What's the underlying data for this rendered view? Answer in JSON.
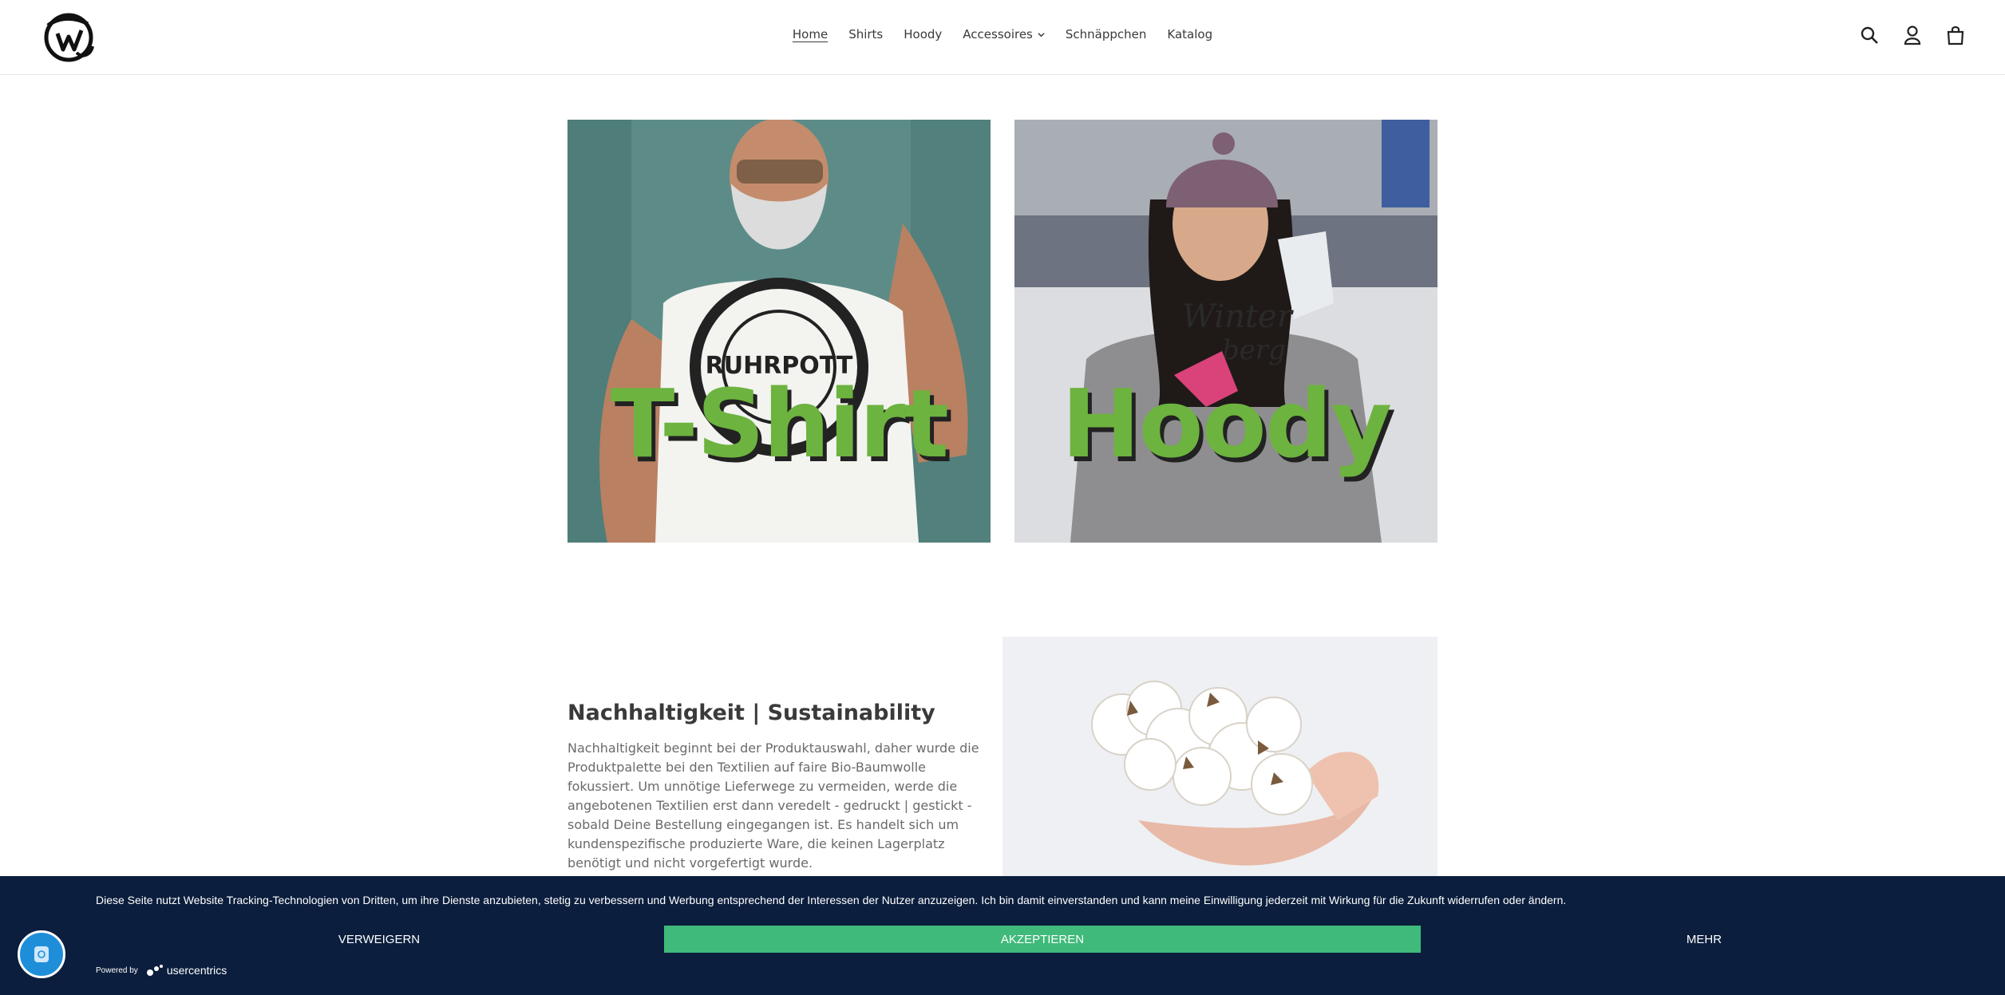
{
  "header": {
    "nav": [
      {
        "label": "Home",
        "active": true
      },
      {
        "label": "Shirts"
      },
      {
        "label": "Hoody"
      },
      {
        "label": "Accessoires",
        "dropdown": true
      },
      {
        "label": "Schnäppchen"
      },
      {
        "label": "Katalog"
      }
    ],
    "icons": [
      "search-icon",
      "account-icon",
      "cart-icon"
    ]
  },
  "tiles": [
    {
      "label": "T-Shirt",
      "image": "man-in-ruhrpott-shirt"
    },
    {
      "label": "Hoody",
      "image": "woman-in-winterberg-hoody"
    }
  ],
  "sustainability": {
    "title": "Nachhaltigkeit | Sustainability",
    "lines": [
      "Nachhaltigkeit beginnt bei der Produktauswahl, daher wurde die",
      "Produktpalette bei den Textilien auf faire Bio-Baumwolle",
      "fokussiert. Um unnötige Lieferwege zu vermeiden, werde die",
      "angebotenen Textilien erst dann veredelt - gedruckt | gestickt -",
      "sobald Deine Bestellung eingegangen ist. Es handelt sich um",
      "kundenspezifische produzierte Ware, die keinen Lagerplatz",
      "benötigt und nicht vorgefertigt wurde."
    ]
  },
  "cookie": {
    "text": "Diese Seite nutzt Website Tracking-Technologien von Dritten, um ihre Dienste anzubieten, stetig zu verbessern und Werbung entsprechend der Interessen der Nutzer anzuzeigen. Ich bin damit einverstanden und kann meine Einwilligung jederzeit mit Wirkung für die Zukunft widerrufen oder ändern.",
    "deny_label": "VERWEIGERN",
    "accept_label": "AKZEPTIEREN",
    "more_label": "MEHR",
    "powered_by": "Powered by",
    "brand": "usercentrics"
  },
  "colors": {
    "banner_bg": "#0b1e3d",
    "accept": "#3fba7a",
    "tile_text": "#6db33f"
  }
}
